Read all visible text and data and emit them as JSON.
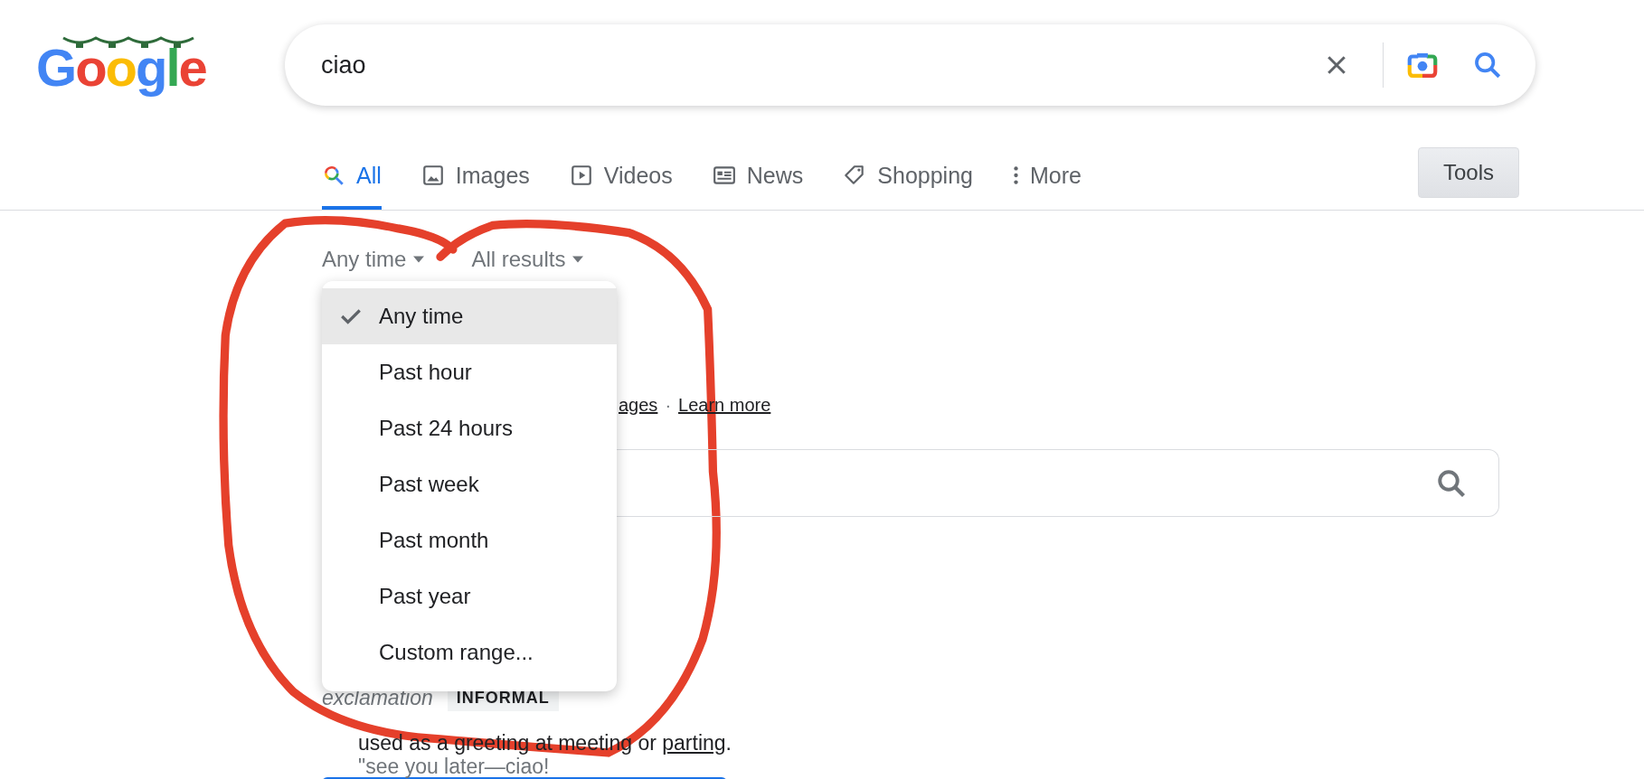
{
  "logo": {
    "text": "Google"
  },
  "search": {
    "value": "ciao"
  },
  "tabs": [
    {
      "label": "All",
      "kind": "search",
      "selected": true
    },
    {
      "label": "Images",
      "kind": "image",
      "selected": false
    },
    {
      "label": "Videos",
      "kind": "video",
      "selected": false
    },
    {
      "label": "News",
      "kind": "news",
      "selected": false
    },
    {
      "label": "Shopping",
      "kind": "tag",
      "selected": false
    },
    {
      "label": "More",
      "kind": "dots",
      "selected": false
    }
  ],
  "tools_button": {
    "label": "Tools",
    "active": true
  },
  "filters": [
    {
      "label": "Any time"
    },
    {
      "label": "All results"
    }
  ],
  "time_menu": [
    {
      "label": "Any time",
      "selected": true
    },
    {
      "label": "Past hour",
      "selected": false
    },
    {
      "label": "Past 24 hours",
      "selected": false
    },
    {
      "label": "Past week",
      "selected": false
    },
    {
      "label": "Past month",
      "selected": false
    },
    {
      "label": "Past year",
      "selected": false
    },
    {
      "label": "Custom range...",
      "selected": false
    }
  ],
  "links_row": {
    "links": [
      "ages",
      "Learn more"
    ],
    "separator": "·"
  },
  "entry": {
    "part_of_speech": "exclamation",
    "register": "INFORMAL",
    "definition_start": "used as a greeting at meeting or ",
    "definition_link": "parting",
    "definition_end": ".",
    "example": "\"see you later—ciao!"
  }
}
